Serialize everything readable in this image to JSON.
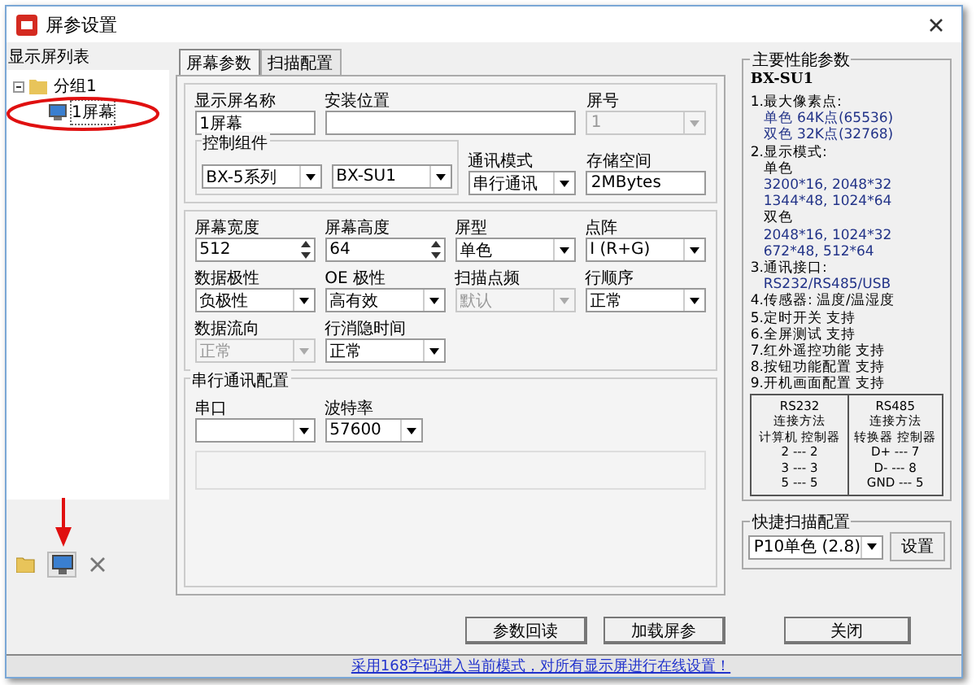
{
  "window": {
    "title": "屏参设置"
  },
  "tree": {
    "title": "显示屏列表",
    "items": [
      {
        "label": "分组1",
        "expanded": true,
        "children": [
          {
            "label": "1屏幕",
            "selected": true
          }
        ]
      }
    ]
  },
  "tabs": [
    {
      "label": "屏幕参数",
      "selected": true
    },
    {
      "label": "扫描配置",
      "selected": false
    }
  ],
  "sections": [
    {
      "lines": [
        [
          {
            "label": "显示屏名称",
            "kind": "text",
            "value": "1屏幕"
          },
          {
            "label": "安装位置",
            "kind": "text"
          },
          {
            "label": "屏号",
            "kind": "combo",
            "value": "1",
            "disabled": true
          }
        ],
        [
          {
            "kind": "group",
            "label": "控制组件",
            "fields": [
              {
                "kind": "combo",
                "value": "BX-5系列"
              },
              {
                "kind": "combo",
                "value": "BX-SU1"
              }
            ]
          },
          {
            "label": "通讯模式",
            "kind": "combo",
            "value": "串行通讯"
          },
          {
            "label": "存储空间",
            "kind": "text",
            "value": "2MBytes"
          }
        ]
      ]
    },
    {
      "lines": [
        [
          {
            "label": "屏幕宽度",
            "kind": "spin",
            "value": "512"
          },
          {
            "label": "屏幕高度",
            "kind": "spin",
            "value": "64"
          },
          {
            "label": "屏型",
            "kind": "combo",
            "value": "单色"
          },
          {
            "label": "点阵",
            "kind": "combo",
            "value": "I (R+G)"
          }
        ],
        [
          {
            "label": "数据极性",
            "kind": "combo",
            "value": "负极性"
          },
          {
            "label": "OE 极性",
            "kind": "combo",
            "value": "高有效"
          },
          {
            "label": "扫描点频",
            "kind": "combo",
            "value": "默认",
            "disabled": true
          },
          {
            "label": "行顺序",
            "kind": "combo",
            "value": "正常"
          }
        ],
        [
          {
            "label": "数据流向",
            "kind": "combo",
            "value": "正常",
            "disabled": true
          },
          {
            "label": "行消隐时间",
            "kind": "combo",
            "value": "正常"
          }
        ]
      ]
    },
    {
      "title": "串行通讯配置",
      "lines": [
        [
          {
            "label": "串口",
            "kind": "combo"
          },
          {
            "label": "波特率",
            "kind": "combo",
            "value": "57600"
          }
        ]
      ]
    }
  ],
  "specs": {
    "title": "主要性能参数",
    "model": "BX-SU1",
    "lines": [
      {
        "kind": "item",
        "text": "1.最大像素点:"
      },
      {
        "kind": "value",
        "text": "单色 64K点(65536)"
      },
      {
        "kind": "value",
        "text": "双色 32K点(32768)"
      },
      {
        "kind": "item",
        "text": "2.显示模式:"
      },
      {
        "kind": "sub",
        "text": "单色"
      },
      {
        "kind": "value",
        "text": "3200*16, 2048*32"
      },
      {
        "kind": "value",
        "text": "1344*48, 1024*64"
      },
      {
        "kind": "sub",
        "text": "双色"
      },
      {
        "kind": "value",
        "text": "2048*16, 1024*32"
      },
      {
        "kind": "value",
        "text": "672*48, 512*64"
      },
      {
        "kind": "item",
        "text": "3.通讯接口:"
      },
      {
        "kind": "value",
        "text": "RS232/RS485/USB"
      },
      {
        "kind": "item",
        "text": "4.传感器: 温度/温湿度"
      },
      {
        "kind": "item",
        "text": "5.定时开关 支持"
      },
      {
        "kind": "item",
        "text": "6.全屏测试 支持"
      },
      {
        "kind": "item",
        "text": "7.红外遥控功能 支持"
      },
      {
        "kind": "item",
        "text": "8.按钮功能配置 支持"
      },
      {
        "kind": "item",
        "text": "9.开机画面配置 支持"
      }
    ],
    "wiring": [
      {
        "title": "RS232",
        "subtitle": "连接方法",
        "header": "计算机  控制器",
        "rows": [
          "2 --- 2",
          "3 --- 3",
          "5 --- 5"
        ]
      },
      {
        "title": "RS485",
        "subtitle": "连接方法",
        "header": "转换器  控制器",
        "rows": [
          "D+ --- 7",
          "D- --- 8",
          "GND --- 5"
        ]
      }
    ]
  },
  "quick_scan": {
    "title": "快捷扫描配置",
    "value": "P10单色 (2.8)",
    "button": "设置"
  },
  "buttons": [
    {
      "label": "参数回读",
      "kind": "action"
    },
    {
      "label": "加载屏参",
      "kind": "action"
    },
    {
      "label": "关闭",
      "kind": "close"
    }
  ],
  "status_bar": "采用168字码进入当前模式，对所有显示屏进行在线设置！"
}
